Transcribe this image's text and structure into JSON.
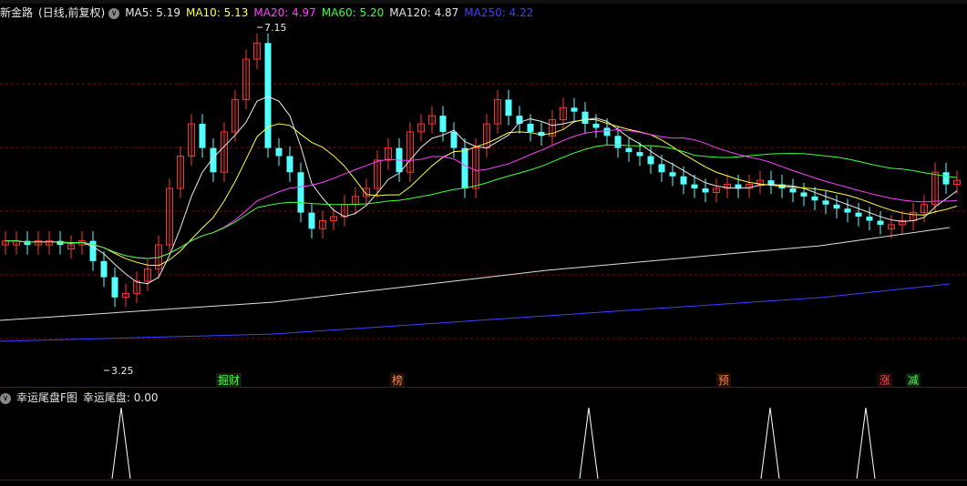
{
  "header": {
    "stock_name": "新金路",
    "period": "(日线,前复权)",
    "ma_items": [
      {
        "label": "MA5: 5.19",
        "color": "#e8e8e8"
      },
      {
        "label": "MA10: 5.13",
        "color": "#ffff40"
      },
      {
        "label": "MA20: 4.97",
        "color": "#ff40ff"
      },
      {
        "label": "MA60: 5.20",
        "color": "#40ff40"
      },
      {
        "label": "MA120: 4.87",
        "color": "#e0e0e0"
      },
      {
        "label": "MA250: 4.22",
        "color": "#4040ff"
      }
    ]
  },
  "main": {
    "high_label": "7.15",
    "low_label": "3.25",
    "tags": [
      {
        "text": "掘财",
        "color": "#40ff40",
        "bg": "#102010"
      },
      {
        "text": "榜",
        "color": "#ff8040",
        "bg": "#201008"
      },
      {
        "text": "预",
        "color": "#ff8040",
        "bg": "#201008"
      },
      {
        "text": "涨",
        "color": "#ff4040",
        "bg": "#200808"
      },
      {
        "text": "减",
        "color": "#40ff40",
        "bg": "#102010"
      }
    ]
  },
  "indicator": {
    "name": "幸运尾盘F图",
    "value_label": "幸运尾盘: 0.00"
  },
  "colors": {
    "up": "#ff3232",
    "down": "#54ffff",
    "grid": "#8b0000",
    "ma5": "#e8e8e8",
    "ma10": "#ffff40",
    "ma20": "#ff40ff",
    "ma60": "#40ff40",
    "ma120": "#e0e0e0",
    "ma250": "#4040ff"
  }
}
